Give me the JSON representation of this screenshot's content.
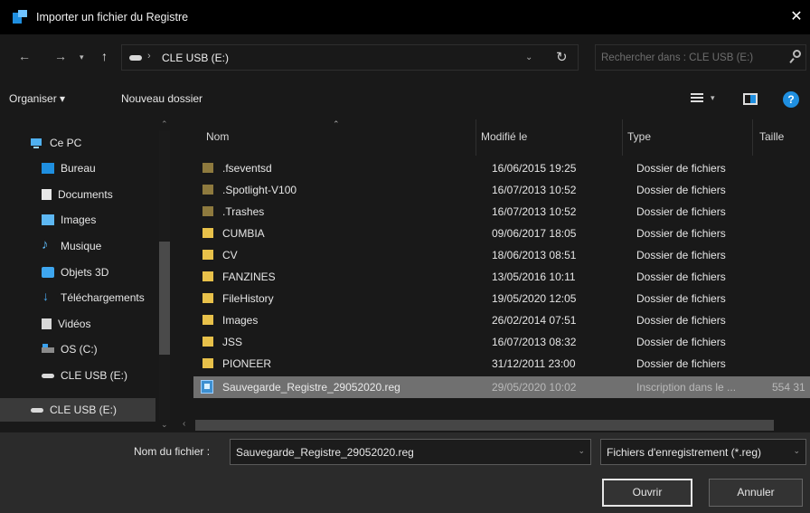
{
  "window": {
    "title": "Importer un fichier du Registre",
    "close_glyph": "✕"
  },
  "address": {
    "path": "CLE USB (E:)",
    "search_placeholder": "Rechercher dans : CLE USB (E:)"
  },
  "toolbar": {
    "organize": "Organiser ▾",
    "new_folder": "Nouveau dossier"
  },
  "sidebar": {
    "items": [
      {
        "label": "Ce PC",
        "icon": "computer-icon"
      },
      {
        "label": "Bureau",
        "icon": "desktop-icon"
      },
      {
        "label": "Documents",
        "icon": "documents-icon"
      },
      {
        "label": "Images",
        "icon": "images-icon"
      },
      {
        "label": "Musique",
        "icon": "music-icon"
      },
      {
        "label": "Objets 3D",
        "icon": "objects-3d-icon"
      },
      {
        "label": "Téléchargements",
        "icon": "downloads-icon"
      },
      {
        "label": "Vidéos",
        "icon": "videos-icon"
      },
      {
        "label": "OS (C:)",
        "icon": "os-drive-icon"
      },
      {
        "label": "CLE USB (E:)",
        "icon": "usb-drive-icon"
      },
      {
        "label": "CLE USB (E:)",
        "icon": "usb-drive-icon"
      }
    ]
  },
  "columns": {
    "name": "Nom",
    "modified": "Modifié le",
    "type": "Type",
    "size": "Taille"
  },
  "files": [
    {
      "name": ".fseventsd",
      "modified": "16/06/2015 19:25",
      "type": "Dossier de fichiers",
      "size": ""
    },
    {
      "name": ".Spotlight-V100",
      "modified": "16/07/2013 10:52",
      "type": "Dossier de fichiers",
      "size": ""
    },
    {
      "name": ".Trashes",
      "modified": "16/07/2013 10:52",
      "type": "Dossier de fichiers",
      "size": ""
    },
    {
      "name": "CUMBIA",
      "modified": "09/06/2017 18:05",
      "type": "Dossier de fichiers",
      "size": ""
    },
    {
      "name": "CV",
      "modified": "18/06/2013 08:51",
      "type": "Dossier de fichiers",
      "size": ""
    },
    {
      "name": "FANZINES",
      "modified": "13/05/2016 10:11",
      "type": "Dossier de fichiers",
      "size": ""
    },
    {
      "name": "FileHistory",
      "modified": "19/05/2020 12:05",
      "type": "Dossier de fichiers",
      "size": ""
    },
    {
      "name": "Images",
      "modified": "26/02/2014 07:51",
      "type": "Dossier de fichiers",
      "size": ""
    },
    {
      "name": "JSS",
      "modified": "16/07/2013 08:32",
      "type": "Dossier de fichiers",
      "size": ""
    },
    {
      "name": "PIONEER",
      "modified": "31/12/2011 23:00",
      "type": "Dossier de fichiers",
      "size": ""
    },
    {
      "name": "Sauvegarde_Registre_29052020.reg",
      "modified": "29/05/2020 10:02",
      "type": "Inscription dans le ...",
      "size": "554 31"
    }
  ],
  "bottom": {
    "filename_label": "Nom du fichier :",
    "filename_value": "Sauvegarde_Registre_29052020.reg",
    "filetype": "Fichiers d'enregistrement (*.reg)",
    "open": "Ouvrir",
    "cancel": "Annuler"
  },
  "colors": {
    "accent": "#1f8fe0",
    "folder": "#e8c14a",
    "selected_row": "#707070"
  }
}
